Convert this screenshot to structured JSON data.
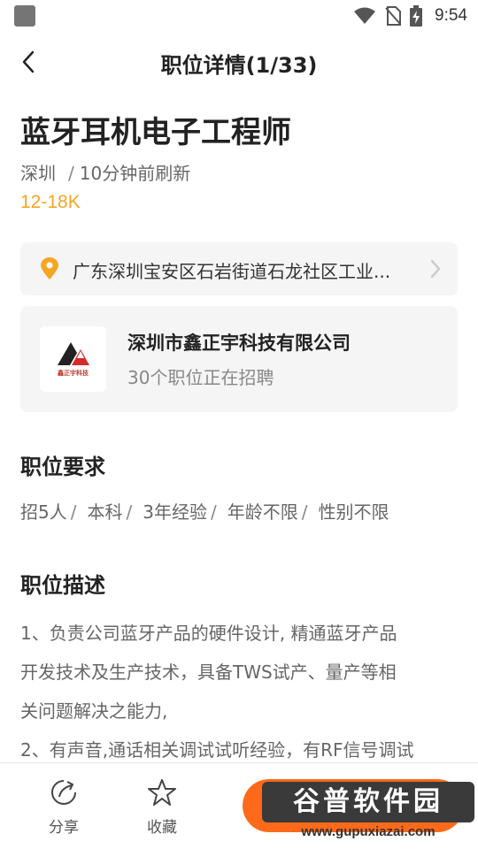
{
  "status_bar": {
    "time": "9:54"
  },
  "nav": {
    "title": "职位详情(1/33)"
  },
  "job": {
    "title": "蓝牙耳机电子工程师",
    "city": "深圳",
    "sep": "/",
    "refreshed": "10分钟前刷新",
    "salary": "12-18K"
  },
  "address": {
    "text": "广东深圳宝安区石岩街道石龙社区工业..."
  },
  "company": {
    "name": "深圳市鑫正宇科技有限公司",
    "jobs_count_text": "30个职位正在招聘",
    "logo_text": "鑫正宇科技"
  },
  "requirements": {
    "title": "职位要求",
    "items": [
      "招5人",
      "本科",
      "3年经验",
      "年龄不限",
      "性别不限"
    ],
    "separator": "/"
  },
  "description": {
    "title": "职位描述",
    "lines": [
      "1、负责公司蓝牙产品的硬件设计, 精通蓝牙产品",
      "开发技术及生产技术，具备TWS试产、量产等相",
      "关问题解决之能力,",
      "2、有声音,通话相关调试试听经验，有RF信号调试"
    ]
  },
  "bottom_bar": {
    "share_label": "分享",
    "favorite_label": "收藏"
  },
  "watermark": {
    "main": "谷普软件园",
    "url": "www.gupuxiazai.com"
  },
  "colors": {
    "accent": "#f5a623",
    "primary_button": "#ff6a1a",
    "card_bg": "#f5f5f5"
  }
}
